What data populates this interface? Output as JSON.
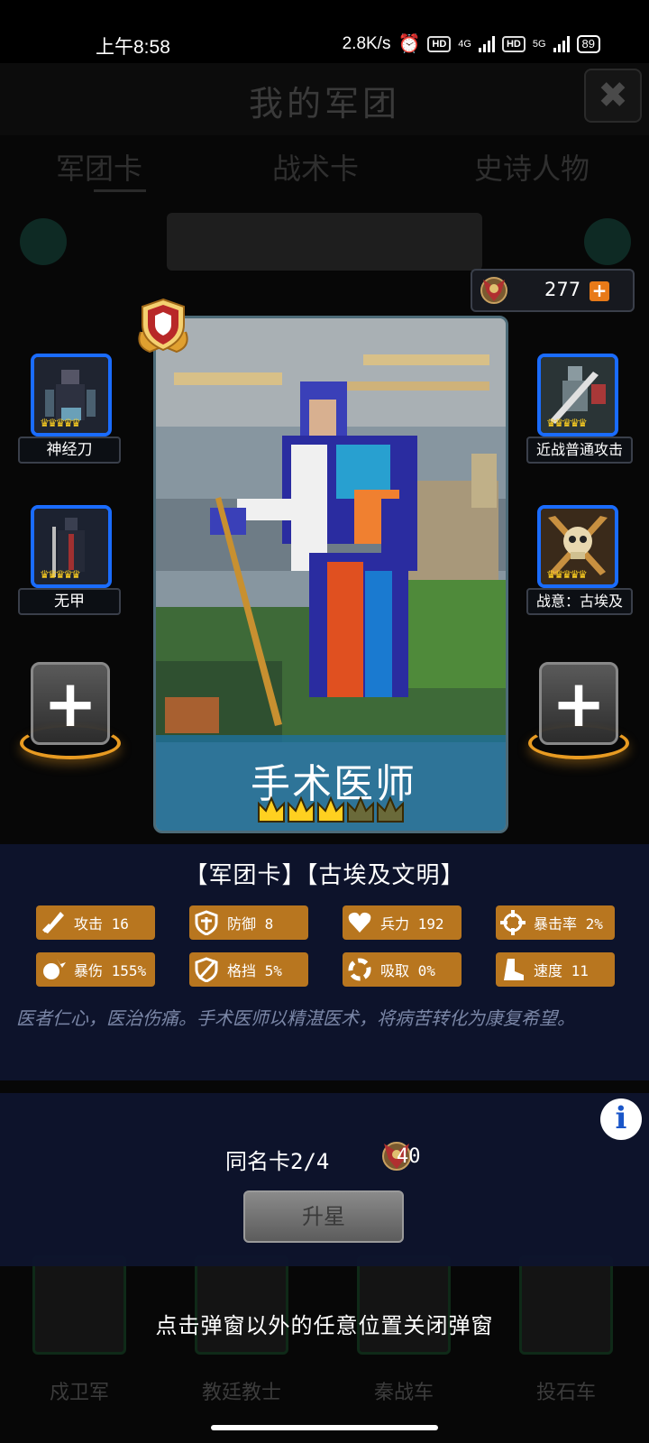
{
  "status_bar": {
    "time": "上午8:58",
    "net_speed": "2.8K/s",
    "hd1": "HD",
    "net1": "4G",
    "hd2": "HD",
    "net2": "5G",
    "battery": "89"
  },
  "background": {
    "title": "我的军团",
    "tabs": [
      "军团卡",
      "战术卡",
      "史诗人物"
    ],
    "unit_labels": [
      "戍卫军",
      "教廷教士",
      "秦战车",
      "投石车"
    ]
  },
  "currency": {
    "value": "277",
    "plus": "+"
  },
  "left_slots": [
    {
      "label": "神经刀",
      "crowns": "♛♛♛♛♛"
    },
    {
      "label": "无甲",
      "crowns": "♛♛♛♛♛"
    }
  ],
  "right_slots": [
    {
      "label": "近战普通攻击",
      "crowns": "♛♛♛♛♛"
    },
    {
      "label": "战意：古埃及",
      "crowns": "♛♛♛♛♛"
    }
  ],
  "add_slot_symbol": "+",
  "card": {
    "name": "手术医师",
    "stars_filled": 3,
    "stars_total": 5,
    "tags": "【军团卡】【古埃及文明】"
  },
  "stats": [
    {
      "label": "攻击 16",
      "icon": "sword-icon"
    },
    {
      "label": "防御 8",
      "icon": "shield-icon"
    },
    {
      "label": "兵力 192",
      "icon": "heart-icon"
    },
    {
      "label": "暴击率 2%",
      "icon": "crosshair-icon"
    },
    {
      "label": "暴伤 155%",
      "icon": "burst-icon"
    },
    {
      "label": "格挡 5%",
      "icon": "block-icon"
    },
    {
      "label": "吸取 0%",
      "icon": "drain-icon"
    },
    {
      "label": "速度 11",
      "icon": "boot-icon"
    }
  ],
  "description": "医者仁心，医治伤痛。手术医师以精湛医术，将病苦转化为康复希望。",
  "upgrade": {
    "duplicate_label": "同名卡2/4",
    "cost": "40",
    "button_label": "升星"
  },
  "info_button": "i",
  "hint": "点击弹窗以外的任意位置关闭弹窗",
  "colors": {
    "slot_border": "#1a6cff",
    "stat_bg": "#b8761f",
    "crown": "#ffd020",
    "panel": "#0e142e"
  }
}
